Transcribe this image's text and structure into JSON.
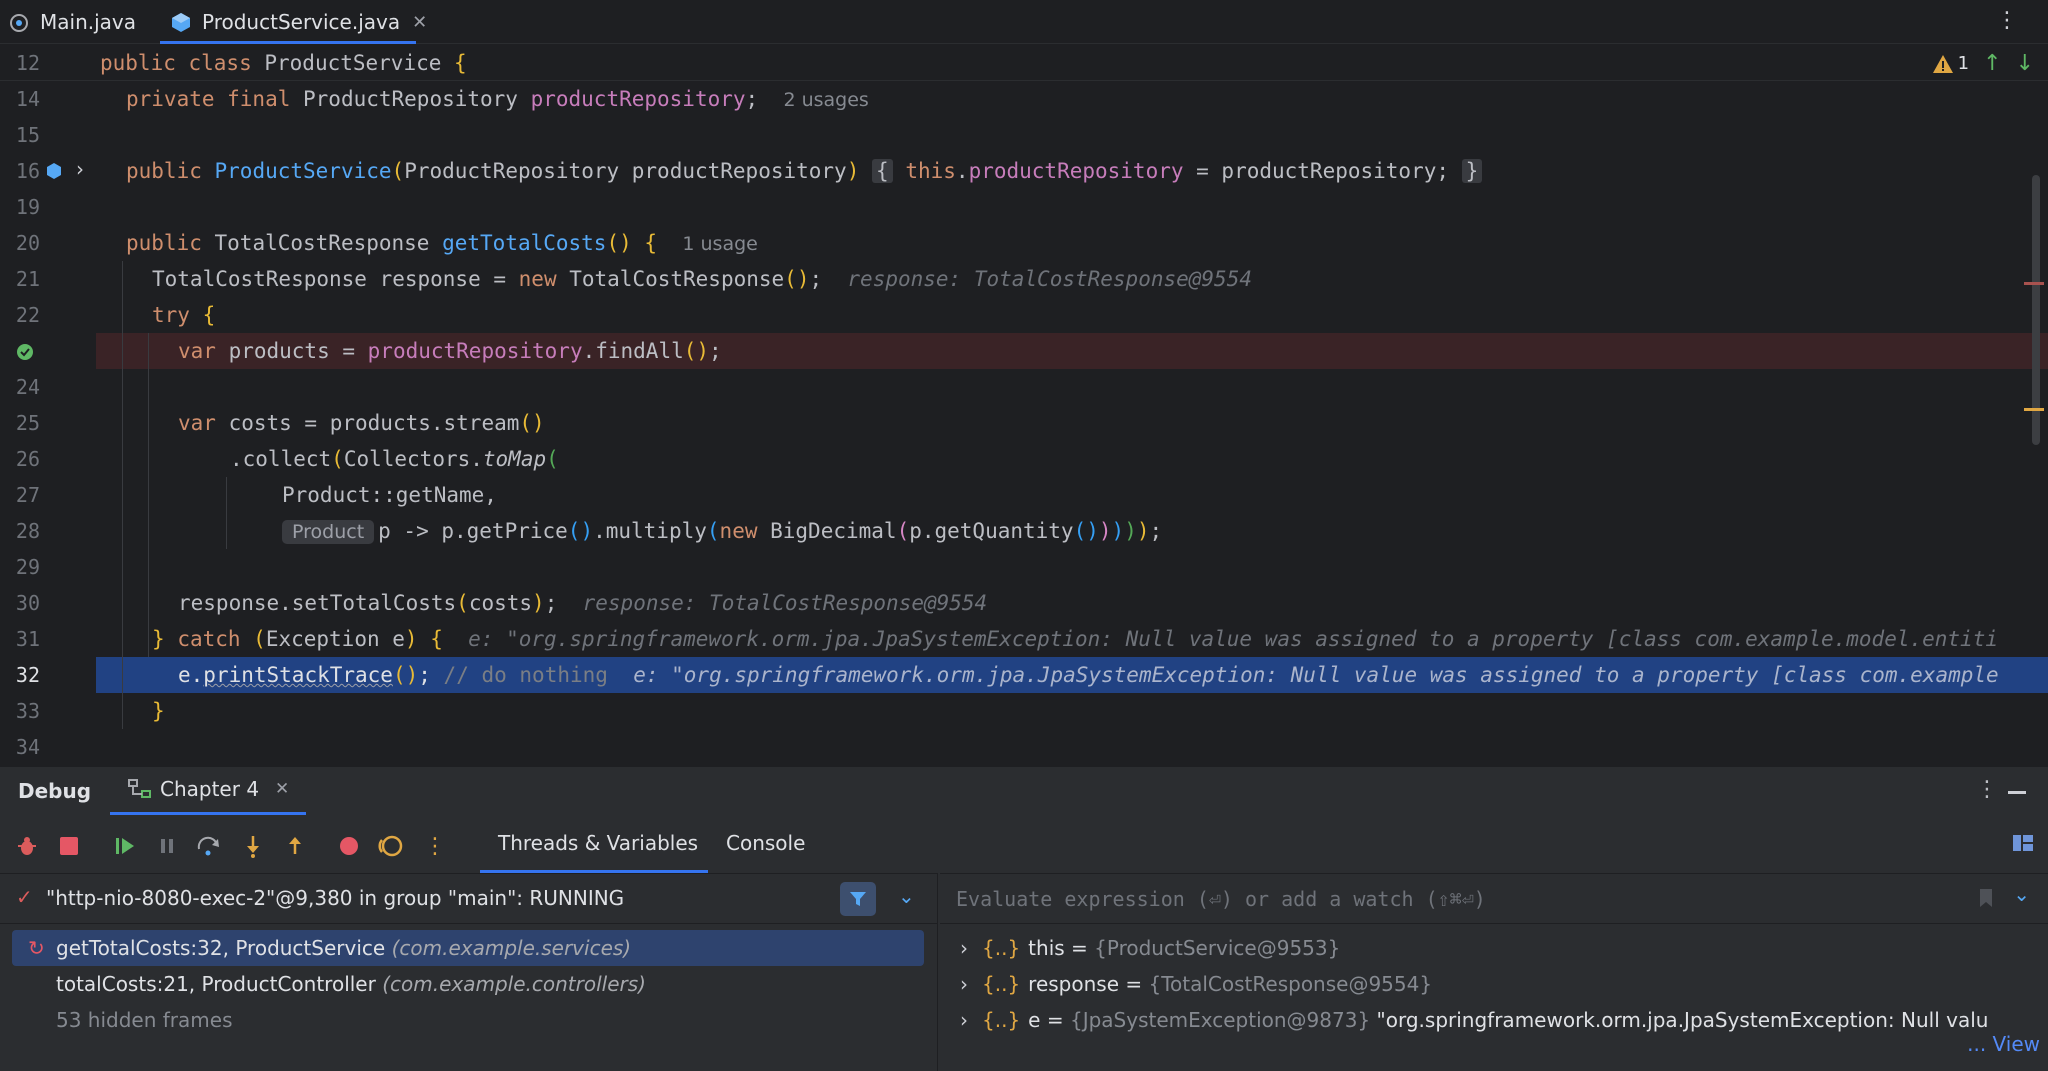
{
  "tabs": {
    "items": [
      {
        "label": "Main.java",
        "icon": "java-class-icon"
      },
      {
        "label": "ProductService.java",
        "icon": "java-class-icon",
        "active": true
      }
    ]
  },
  "editor": {
    "warnings_count": "1",
    "lines": {
      "l12": {
        "n": "12"
      },
      "l14": {
        "n": "14"
      },
      "l15": {
        "n": "15"
      },
      "l16": {
        "n": "16"
      },
      "l19": {
        "n": "19"
      },
      "l20": {
        "n": "20"
      },
      "l21": {
        "n": "21"
      },
      "l22": {
        "n": "22"
      },
      "l23": {
        "n": ""
      },
      "l24": {
        "n": "24"
      },
      "l25": {
        "n": "25"
      },
      "l26": {
        "n": "26"
      },
      "l27": {
        "n": "27"
      },
      "l28": {
        "n": "28"
      },
      "l29": {
        "n": "29"
      },
      "l30": {
        "n": "30"
      },
      "l31": {
        "n": "31"
      },
      "l32": {
        "n": "32"
      },
      "l33": {
        "n": "33"
      },
      "l34": {
        "n": "34"
      }
    },
    "usages_2": "2 usages",
    "usages_1": "1 usage",
    "param_hint": "Product",
    "inline_response_21": "response: TotalCostResponse@9554",
    "inline_response_30": "response: TotalCostResponse@9554",
    "inline_e_31": "e: \"org.springframework.orm.jpa.JpaSystemException: Null value was assigned to a property [class com.example.model.entiti",
    "inline_e_32": "e: \"org.springframework.orm.jpa.JpaSystemException: Null value was assigned to a property [class com.example",
    "comment_32": "// do nothing"
  },
  "debug": {
    "title": "Debug",
    "session_tab": "Chapter 4",
    "subtabs": [
      "Threads & Variables",
      "Console"
    ],
    "thread": "\"http-nio-8080-exec-2\"@9,380 in group \"main\": RUNNING",
    "frames": [
      {
        "method": "getTotalCosts:32, ProductService",
        "pkg": "(com.example.services)"
      },
      {
        "method": "totalCosts:21, ProductController",
        "pkg": "(com.example.controllers)"
      },
      {
        "method": "53 hidden frames",
        "pkg": ""
      }
    ],
    "eval_placeholder": "Evaluate expression (⏎) or add a watch (⇧⌘⏎)",
    "variables": [
      {
        "name": "this",
        "value": "{ProductService@9553}",
        "extra": ""
      },
      {
        "name": "response",
        "value": "{TotalCostResponse@9554}",
        "extra": ""
      },
      {
        "name": "e",
        "value": "{JpaSystemException@9873}",
        "extra": "\"org.springframework.orm.jpa.JpaSystemException: Null valu"
      }
    ],
    "view_link": "... View"
  },
  "colors": {
    "accent": "#3574f0",
    "error_line": "#3a2326",
    "current_line": "#214283"
  }
}
